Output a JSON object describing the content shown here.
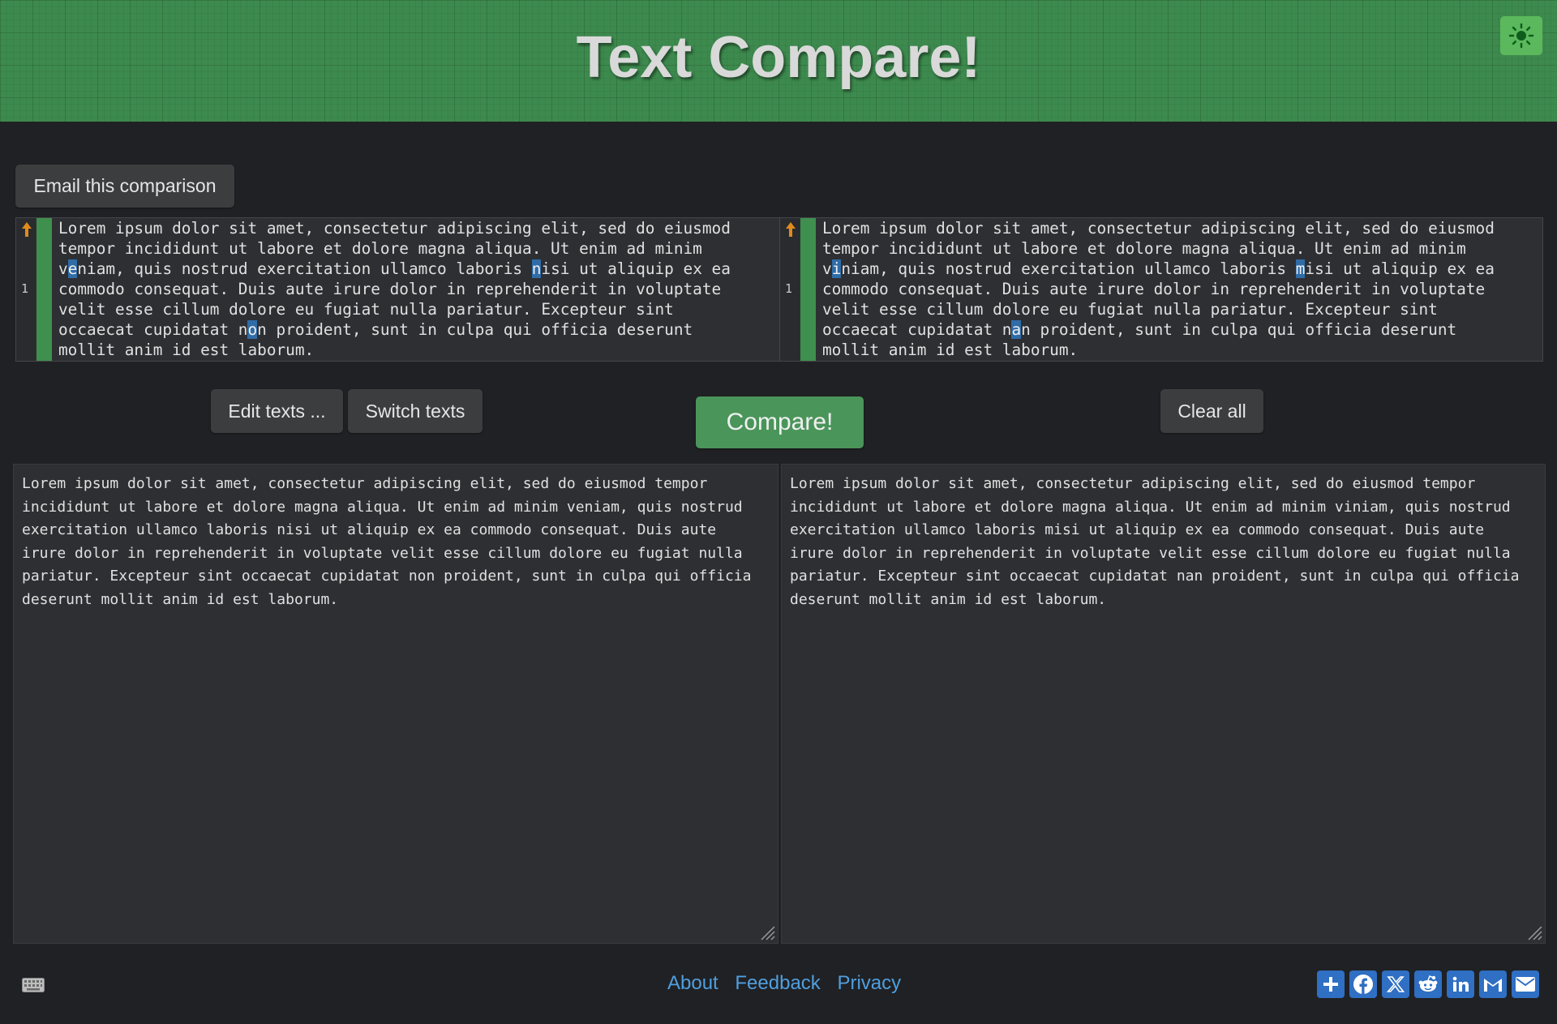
{
  "header": {
    "title": "Text Compare!",
    "theme_toggle_icon": "sun-icon"
  },
  "toolbar": {
    "email_label": "Email this comparison",
    "edit_label": "Edit texts ...",
    "switch_label": "Switch texts",
    "compare_label": "Compare!",
    "clear_label": "Clear all"
  },
  "diff": {
    "line_number": "1",
    "left": [
      [
        {
          "t": "Lorem ipsum dolor sit amet, consectetur adipiscing elit, sed do eiusmod"
        }
      ],
      [
        {
          "t": "tempor incididunt ut labore et dolore magna aliqua. Ut enim ad minim"
        }
      ],
      [
        {
          "t": "v"
        },
        {
          "t": "e",
          "hl": true
        },
        {
          "t": "niam, quis nostrud exercitation ullamco laboris "
        },
        {
          "t": "n",
          "hl": true
        },
        {
          "t": "isi ut aliquip ex ea"
        }
      ],
      [
        {
          "t": "commodo consequat. Duis aute irure dolor in reprehenderit in voluptate"
        }
      ],
      [
        {
          "t": "velit esse cillum dolore eu fugiat nulla pariatur. Excepteur sint"
        }
      ],
      [
        {
          "t": "occaecat cupidatat n"
        },
        {
          "t": "o",
          "hl": true
        },
        {
          "t": "n proident, sunt in culpa qui officia deserunt"
        }
      ],
      [
        {
          "t": "mollit anim id est laborum."
        }
      ]
    ],
    "right": [
      [
        {
          "t": "Lorem ipsum dolor sit amet, consectetur adipiscing elit, sed do eiusmod"
        }
      ],
      [
        {
          "t": "tempor incididunt ut labore et dolore magna aliqua. Ut enim ad minim"
        }
      ],
      [
        {
          "t": "v"
        },
        {
          "t": "i",
          "hl": true
        },
        {
          "t": "niam, quis nostrud exercitation ullamco laboris "
        },
        {
          "t": "m",
          "hl": true
        },
        {
          "t": "isi ut aliquip ex ea"
        }
      ],
      [
        {
          "t": "commodo consequat. Duis aute irure dolor in reprehenderit in voluptate"
        }
      ],
      [
        {
          "t": "velit esse cillum dolore eu fugiat nulla pariatur. Excepteur sint"
        }
      ],
      [
        {
          "t": "occaecat cupidatat n"
        },
        {
          "t": "a",
          "hl": true
        },
        {
          "t": "n proident, sunt in culpa qui officia deserunt"
        }
      ],
      [
        {
          "t": "mollit anim id est laborum."
        }
      ]
    ]
  },
  "editors": {
    "left": "Lorem ipsum dolor sit amet, consectetur adipiscing elit, sed do eiusmod tempor\nincididunt ut labore et dolore magna aliqua. Ut enim ad minim veniam, quis nostrud\nexercitation ullamco laboris nisi ut aliquip ex ea commodo consequat. Duis aute\nirure dolor in reprehenderit in voluptate velit esse cillum dolore eu fugiat nulla\npariatur. Excepteur sint occaecat cupidatat non proident, sunt in culpa qui officia\ndeserunt mollit anim id est laborum.",
    "right": "Lorem ipsum dolor sit amet, consectetur adipiscing elit, sed do eiusmod tempor\nincididunt ut labore et dolore magna aliqua. Ut enim ad minim viniam, quis nostrud\nexercitation ullamco laboris misi ut aliquip ex ea commodo consequat. Duis aute\nirure dolor in reprehenderit in voluptate velit esse cillum dolore eu fugiat nulla\npariatur. Excepteur sint occaecat cupidatat nan proident, sunt in culpa qui officia\ndeserunt mollit anim id est laborum."
  },
  "footer": {
    "about": "About",
    "feedback": "Feedback",
    "privacy": "Privacy",
    "keyboard_icon": "keyboard-icon",
    "share_icons": [
      "plus-icon",
      "facebook-icon",
      "x-icon",
      "reddit-icon",
      "linkedin-icon",
      "gmail-icon",
      "email-icon"
    ]
  },
  "colors": {
    "accent_green": "#4a955a",
    "highlight_blue": "#2f6ca8",
    "link_blue": "#4f9fe0",
    "share_blue": "#2f6fc4"
  }
}
